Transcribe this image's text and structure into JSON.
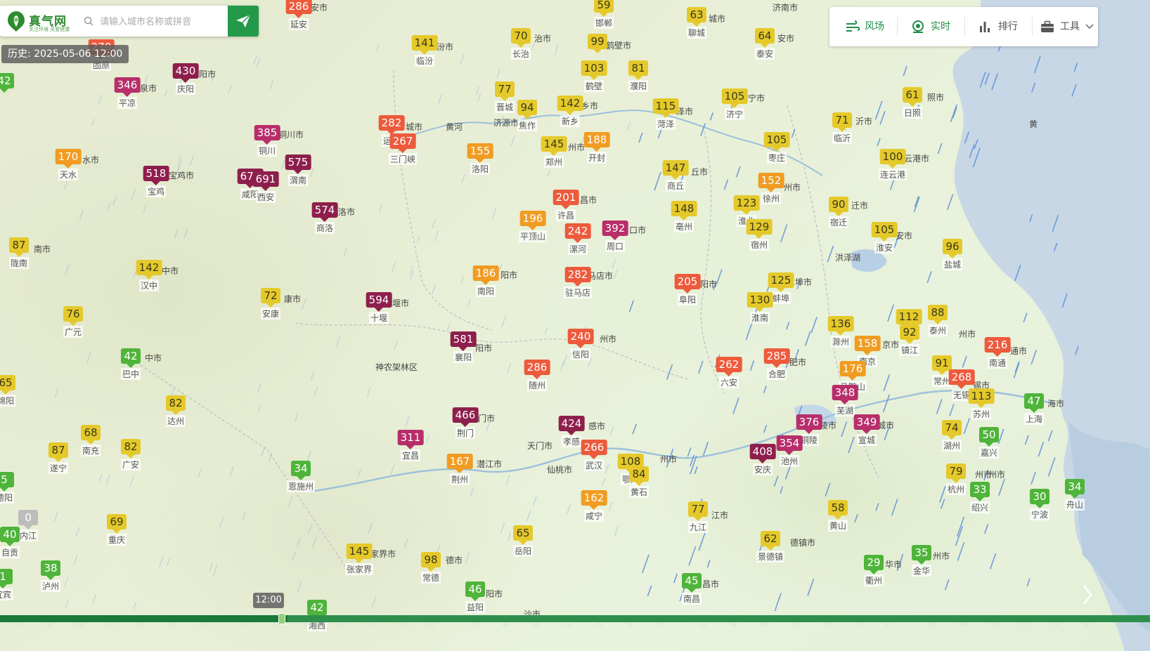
{
  "brand": {
    "name": "真气网",
    "slogan": "关注环境 关爱健康",
    "color": "#2e8b2f"
  },
  "search": {
    "placeholder": "请输入城市名称或拼音",
    "button_icon": "send-arrow-icon"
  },
  "history_label": "历史: 2025-05-06 12:00",
  "toolbar": [
    {
      "icon": "wind-icon",
      "label": "风场"
    },
    {
      "icon": "location-pin-icon",
      "label": "实时"
    },
    {
      "icon": "bar-chart-icon",
      "label": "排行"
    },
    {
      "icon": "toolbox-icon",
      "label": "工具"
    }
  ],
  "timeline": {
    "current_time": "12:00",
    "progress_pct": 25
  },
  "aqi_colors": {
    "good": "#4fb43a",
    "moderate": "#e5c92b",
    "unhealthy_sensitive": "#f09c22",
    "unhealthy": "#ed5a3c",
    "very_unhealthy": "#b82e6a",
    "hazardous": "#8e1f4c"
  },
  "cities": [
    {
      "aqi": "286",
      "name": "延安"
    },
    {
      "aqi": "59",
      "name": "邯郸"
    },
    {
      "aqi": "63",
      "name": "聊城"
    },
    {
      "aqi": "64",
      "name": "泰安"
    },
    {
      "aqi": "141",
      "name": "临汾"
    },
    {
      "aqi": "70",
      "name": "长治"
    },
    {
      "aqi": "99",
      "name": ""
    },
    {
      "aqi": "103",
      "name": "鹤壁"
    },
    {
      "aqi": "81",
      "name": "濮阳"
    },
    {
      "aqi": "270",
      "name": "固原"
    },
    {
      "aqi": "430",
      "name": "庆阳"
    },
    {
      "aqi": "346",
      "name": "平凉"
    },
    {
      "aqi": "42",
      "name": ""
    },
    {
      "aqi": "77",
      "name": "晋城"
    },
    {
      "aqi": "94",
      "name": "焦作"
    },
    {
      "aqi": "142",
      "name": "新乡"
    },
    {
      "aqi": "115",
      "name": "菏泽"
    },
    {
      "aqi": "105",
      "name": "济宁"
    },
    {
      "aqi": "61",
      "name": "日照"
    },
    {
      "aqi": "282",
      "name": "运城"
    },
    {
      "aqi": "267",
      "name": "三门峡"
    },
    {
      "aqi": "385",
      "name": "铜川"
    },
    {
      "aqi": "71",
      "name": "临沂"
    },
    {
      "aqi": "155",
      "name": "洛阳"
    },
    {
      "aqi": "145",
      "name": "郑州"
    },
    {
      "aqi": "188",
      "name": "开封"
    },
    {
      "aqi": "105",
      "name": "枣庄"
    },
    {
      "aqi": "170",
      "name": "天水"
    },
    {
      "aqi": "518",
      "name": "宝鸡"
    },
    {
      "aqi": "678",
      "name": "咸阳"
    },
    {
      "aqi": "691",
      "name": "西安"
    },
    {
      "aqi": "575",
      "name": "渭南"
    },
    {
      "aqi": "147",
      "name": "商丘"
    },
    {
      "aqi": "100",
      "name": "连云港"
    },
    {
      "aqi": "152",
      "name": "徐州"
    },
    {
      "aqi": "574",
      "name": "商洛"
    },
    {
      "aqi": "201",
      "name": "许昌"
    },
    {
      "aqi": "196",
      "name": "平顶山"
    },
    {
      "aqi": "242",
      "name": "漯河"
    },
    {
      "aqi": "392",
      "name": "周口"
    },
    {
      "aqi": "148",
      "name": "亳州"
    },
    {
      "aqi": "123",
      "name": "淮北"
    },
    {
      "aqi": "129",
      "name": "宿州"
    },
    {
      "aqi": "90",
      "name": "宿迁"
    },
    {
      "aqi": "105",
      "name": "淮安"
    },
    {
      "aqi": "96",
      "name": "盐城"
    },
    {
      "aqi": "87",
      "name": "陇南"
    },
    {
      "aqi": "142",
      "name": "汉中"
    },
    {
      "aqi": "186",
      "name": "南阳"
    },
    {
      "aqi": "282",
      "name": "驻马店"
    },
    {
      "aqi": "205",
      "name": "阜阳"
    },
    {
      "aqi": "125",
      "name": "蚌埠"
    },
    {
      "aqi": "72",
      "name": "安康"
    },
    {
      "aqi": "594",
      "name": "十堰"
    },
    {
      "aqi": "130",
      "name": "淮南"
    },
    {
      "aqi": "136",
      "name": "滁州"
    },
    {
      "aqi": "112",
      "name": "扬州"
    },
    {
      "aqi": "88",
      "name": "泰州"
    },
    {
      "aqi": "76",
      "name": "广元"
    },
    {
      "aqi": "92",
      "name": "镇江"
    },
    {
      "aqi": "158",
      "name": "南京"
    },
    {
      "aqi": "240",
      "name": "信阳"
    },
    {
      "aqi": "581",
      "name": "襄阳"
    },
    {
      "aqi": "42",
      "name": "巴中"
    },
    {
      "aqi": "216",
      "name": "南通"
    },
    {
      "aqi": "286",
      "name": "随州"
    },
    {
      "aqi": "262",
      "name": "六安"
    },
    {
      "aqi": "285",
      "name": "合肥"
    },
    {
      "aqi": "176",
      "name": "马鞍山"
    },
    {
      "aqi": "91",
      "name": "常州"
    },
    {
      "aqi": "268",
      "name": "无锡"
    },
    {
      "aqi": "65",
      "name": "绵阳"
    },
    {
      "aqi": "82",
      "name": "达州"
    },
    {
      "aqi": "348",
      "name": "芜湖"
    },
    {
      "aqi": "113",
      "name": "苏州"
    },
    {
      "aqi": "47",
      "name": "上海"
    },
    {
      "aqi": "466",
      "name": "荆门"
    },
    {
      "aqi": "424",
      "name": "孝感"
    },
    {
      "aqi": "376",
      "name": "铜陵"
    },
    {
      "aqi": "349",
      "name": "宣城"
    },
    {
      "aqi": "68",
      "name": "南充"
    },
    {
      "aqi": "311",
      "name": "宜昌"
    },
    {
      "aqi": "74",
      "name": "湖州"
    },
    {
      "aqi": "50",
      "name": "嘉兴"
    },
    {
      "aqi": "87",
      "name": "遂宁"
    },
    {
      "aqi": "82",
      "name": "广安"
    },
    {
      "aqi": "266",
      "name": "武汉"
    },
    {
      "aqi": "354",
      "name": "池州"
    },
    {
      "aqi": "408",
      "name": "安庆"
    },
    {
      "aqi": "5",
      "name": "德阳"
    },
    {
      "aqi": "34",
      "name": "恩施州"
    },
    {
      "aqi": "167",
      "name": "荆州"
    },
    {
      "aqi": "108",
      "name": "鄂州"
    },
    {
      "aqi": "84",
      "name": "黄石"
    },
    {
      "aqi": "79",
      "name": "杭州"
    },
    {
      "aqi": "33",
      "name": "绍兴"
    },
    {
      "aqi": "34",
      "name": "舟山"
    },
    {
      "aqi": "30",
      "name": "宁波"
    },
    {
      "aqi": "162",
      "name": "咸宁"
    },
    {
      "aqi": "0",
      "name": "内江"
    },
    {
      "aqi": "77",
      "name": "九江"
    },
    {
      "aqi": "58",
      "name": "黄山"
    },
    {
      "aqi": "69",
      "name": "重庆"
    },
    {
      "aqi": "40",
      "name": "自贡"
    },
    {
      "aqi": "65",
      "name": "岳阳"
    },
    {
      "aqi": "62",
      "name": "景德镇"
    },
    {
      "aqi": "145",
      "name": "张家界"
    },
    {
      "aqi": "98",
      "name": "常德"
    },
    {
      "aqi": "38",
      "name": "泸州"
    },
    {
      "aqi": "35",
      "name": "金华"
    },
    {
      "aqi": "29",
      "name": "衢州"
    },
    {
      "aqi": "1",
      "name": "宜宾"
    },
    {
      "aqi": "45",
      "name": "南昌"
    },
    {
      "aqi": "46",
      "name": "益阳"
    },
    {
      "aqi": "42",
      "name": "湘西"
    }
  ],
  "place_labels": [
    "安市",
    "阳市",
    "济南市",
    "城市",
    "治市",
    "安市",
    "汾市",
    "鹤壁市",
    "乡市",
    "泉市",
    "宁市",
    "照市",
    "城市",
    "济源市",
    "州市",
    "泽市",
    "沂市",
    "水市",
    "宝鸡市",
    "铜川市",
    "阳市",
    "丘市",
    "云港市",
    "洛市",
    "昌市",
    "口市",
    "州市",
    "迁市",
    "安市",
    "南市",
    "中市",
    "阳市",
    "马店市",
    "阳市",
    "埠市",
    "康市",
    "堰市",
    "阳市",
    "州市",
    "中市",
    "肥市",
    "京市",
    "通市",
    "州市",
    "锡市",
    "州市",
    "海市",
    "门市",
    "感市",
    "陵市",
    "城市",
    "天门市",
    "潜江市",
    "仙桃市",
    "州市",
    "江市",
    "州市",
    "神农架林区",
    "黄河",
    "洪泽湖",
    "黄",
    "昌市",
    "德镇市",
    "华市",
    "州市",
    "家界市",
    "德市",
    "阳市",
    "沙市"
  ]
}
